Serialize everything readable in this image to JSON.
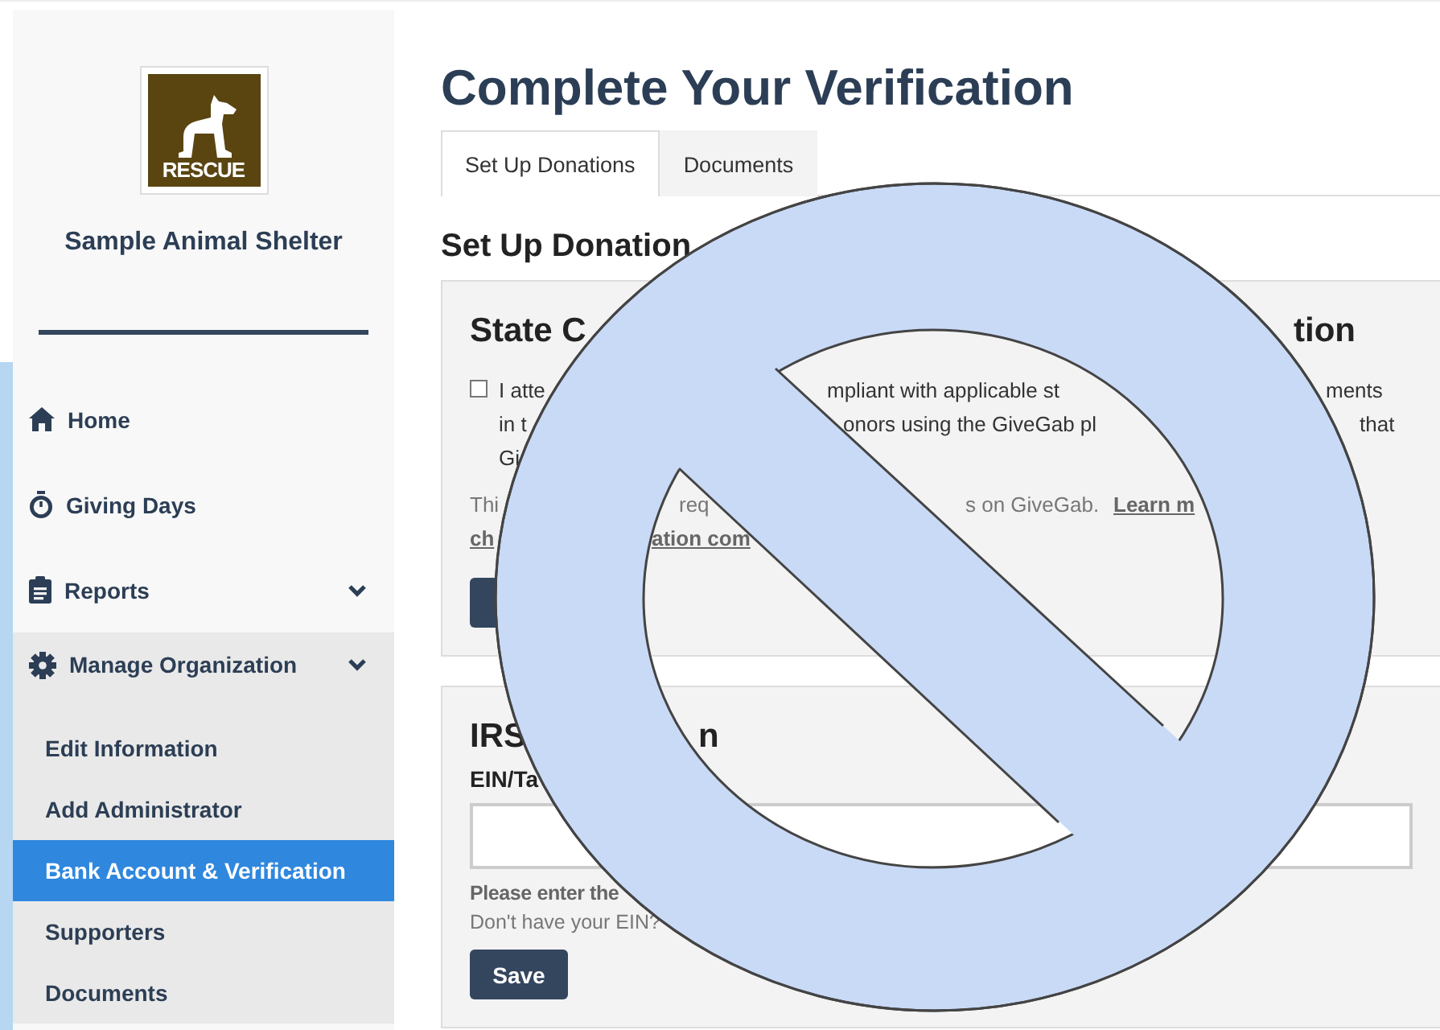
{
  "sidebar": {
    "logo_text": "RESCUE",
    "org_name": "Sample Animal Shelter",
    "nav": [
      {
        "label": "Home"
      },
      {
        "label": "Giving Days"
      },
      {
        "label": "Reports",
        "expanded": false
      },
      {
        "label": "Manage Organization",
        "expanded": true,
        "children": [
          {
            "label": "Edit Information",
            "selected": false
          },
          {
            "label": "Add Administrator",
            "selected": false
          },
          {
            "label": "Bank Account & Verification",
            "selected": true
          },
          {
            "label": "Supporters",
            "selected": false
          },
          {
            "label": "Documents",
            "selected": false
          }
        ]
      }
    ]
  },
  "main": {
    "title": "Complete Your Verification",
    "tabs": [
      {
        "label": "Set Up Donations",
        "selected": true
      },
      {
        "label": "Documents",
        "selected": false
      }
    ],
    "section_title": "Set Up Donation",
    "state_card": {
      "title": [
        "State C",
        "tion"
      ],
      "attest_checked": false,
      "attest_lines": [
        [
          "I atte",
          "mpliant with applicable st",
          "ments"
        ],
        [
          "in t",
          "onors using the GiveGab pl",
          "that"
        ],
        [
          "Gi"
        ]
      ],
      "note_lines": [
        [
          {
            "text": "Thi",
            "kind": "text"
          },
          {
            "text": "req",
            "kind": "text"
          },
          {
            "text": "s on GiveGab.",
            "kind": "text"
          },
          {
            "text": "Learn m",
            "kind": "link"
          }
        ],
        [
          {
            "text": "ch",
            "kind": "link"
          },
          {
            "text": "ation com",
            "kind": "link"
          }
        ]
      ]
    },
    "irs_card": {
      "title": [
        "IRS",
        "n"
      ],
      "field_label": "EIN/Ta",
      "hint": "Please enter the",
      "help": "Don't have your EIN?",
      "save": "Save"
    }
  }
}
